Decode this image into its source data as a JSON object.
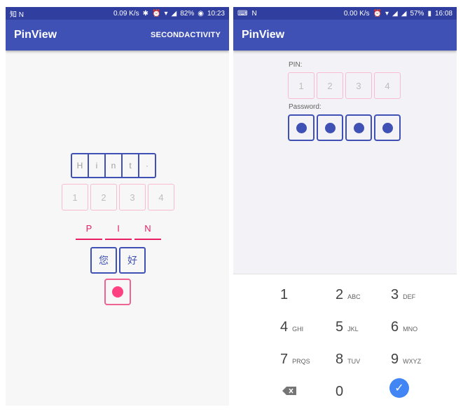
{
  "left": {
    "status": {
      "carrier_icons": "知 N",
      "speed": "0.09 K/s",
      "battery": "82%",
      "time": "10:23"
    },
    "appbar": {
      "title": "PinView",
      "action": "SECONDACTIVITY"
    },
    "hint_chars": [
      "H",
      "i",
      "n",
      "t",
      "·"
    ],
    "pin_pink": [
      "1",
      "2",
      "3",
      "4"
    ],
    "pin_line": [
      "P",
      "I",
      "N"
    ],
    "chinese": [
      "您",
      "好"
    ]
  },
  "right": {
    "status": {
      "speed": "0.00 K/s",
      "battery": "57%",
      "time": "16:08"
    },
    "appbar": {
      "title": "PinView"
    },
    "pin_label": "PIN:",
    "pin_values": [
      "1",
      "2",
      "3",
      "4"
    ],
    "password_label": "Password:",
    "keypad": [
      {
        "num": "1",
        "letters": ""
      },
      {
        "num": "2",
        "letters": "ABC"
      },
      {
        "num": "3",
        "letters": "DEF"
      },
      {
        "num": "4",
        "letters": "GHI"
      },
      {
        "num": "5",
        "letters": "JKL"
      },
      {
        "num": "6",
        "letters": "MNO"
      },
      {
        "num": "7",
        "letters": "PRQS"
      },
      {
        "num": "8",
        "letters": "TUV"
      },
      {
        "num": "9",
        "letters": "WXYZ"
      },
      {
        "num": "0",
        "letters": ""
      }
    ]
  },
  "colors": {
    "primary": "#3f51b5",
    "primary_dark": "#303f9f",
    "accent": "#ff4081",
    "pink_light": "#f8bbd0",
    "keypad_done": "#4285f4"
  },
  "icons": [
    "bluetooth-icon",
    "alarm-icon",
    "wifi-icon",
    "signal-icon",
    "battery-icon",
    "backspace-icon",
    "checkmark-icon"
  ]
}
